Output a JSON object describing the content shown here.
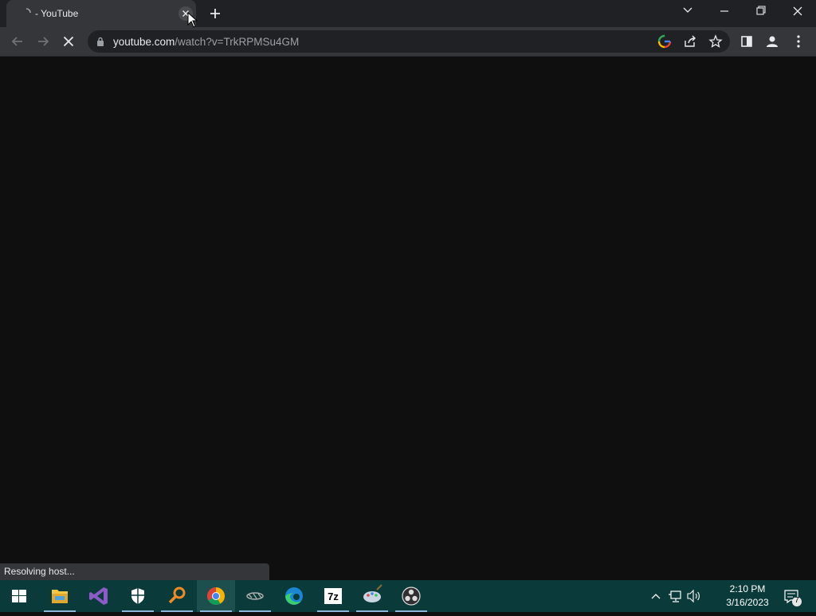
{
  "browser": {
    "tab": {
      "title": " - YouTube"
    },
    "omnibox": {
      "url_host": "youtube.com",
      "url_path": "/watch?v=TrkRPMSu4GM"
    },
    "status_text": "Resolving host..."
  },
  "taskbar": {
    "apps": [
      "start-button",
      "file-explorer",
      "visual-studio",
      "security",
      "search-tool",
      "chrome",
      "media-app",
      "edge",
      "7zip",
      "paint-app",
      "obs"
    ],
    "active_app": "chrome",
    "clock": {
      "time": "2:10 PM",
      "date": "3/16/2023"
    },
    "notifications_count": "7"
  },
  "colors": {
    "page_background": "#0f0f0f",
    "chrome_toolbar": "#35363a",
    "taskbar": "#0b3a3a"
  }
}
